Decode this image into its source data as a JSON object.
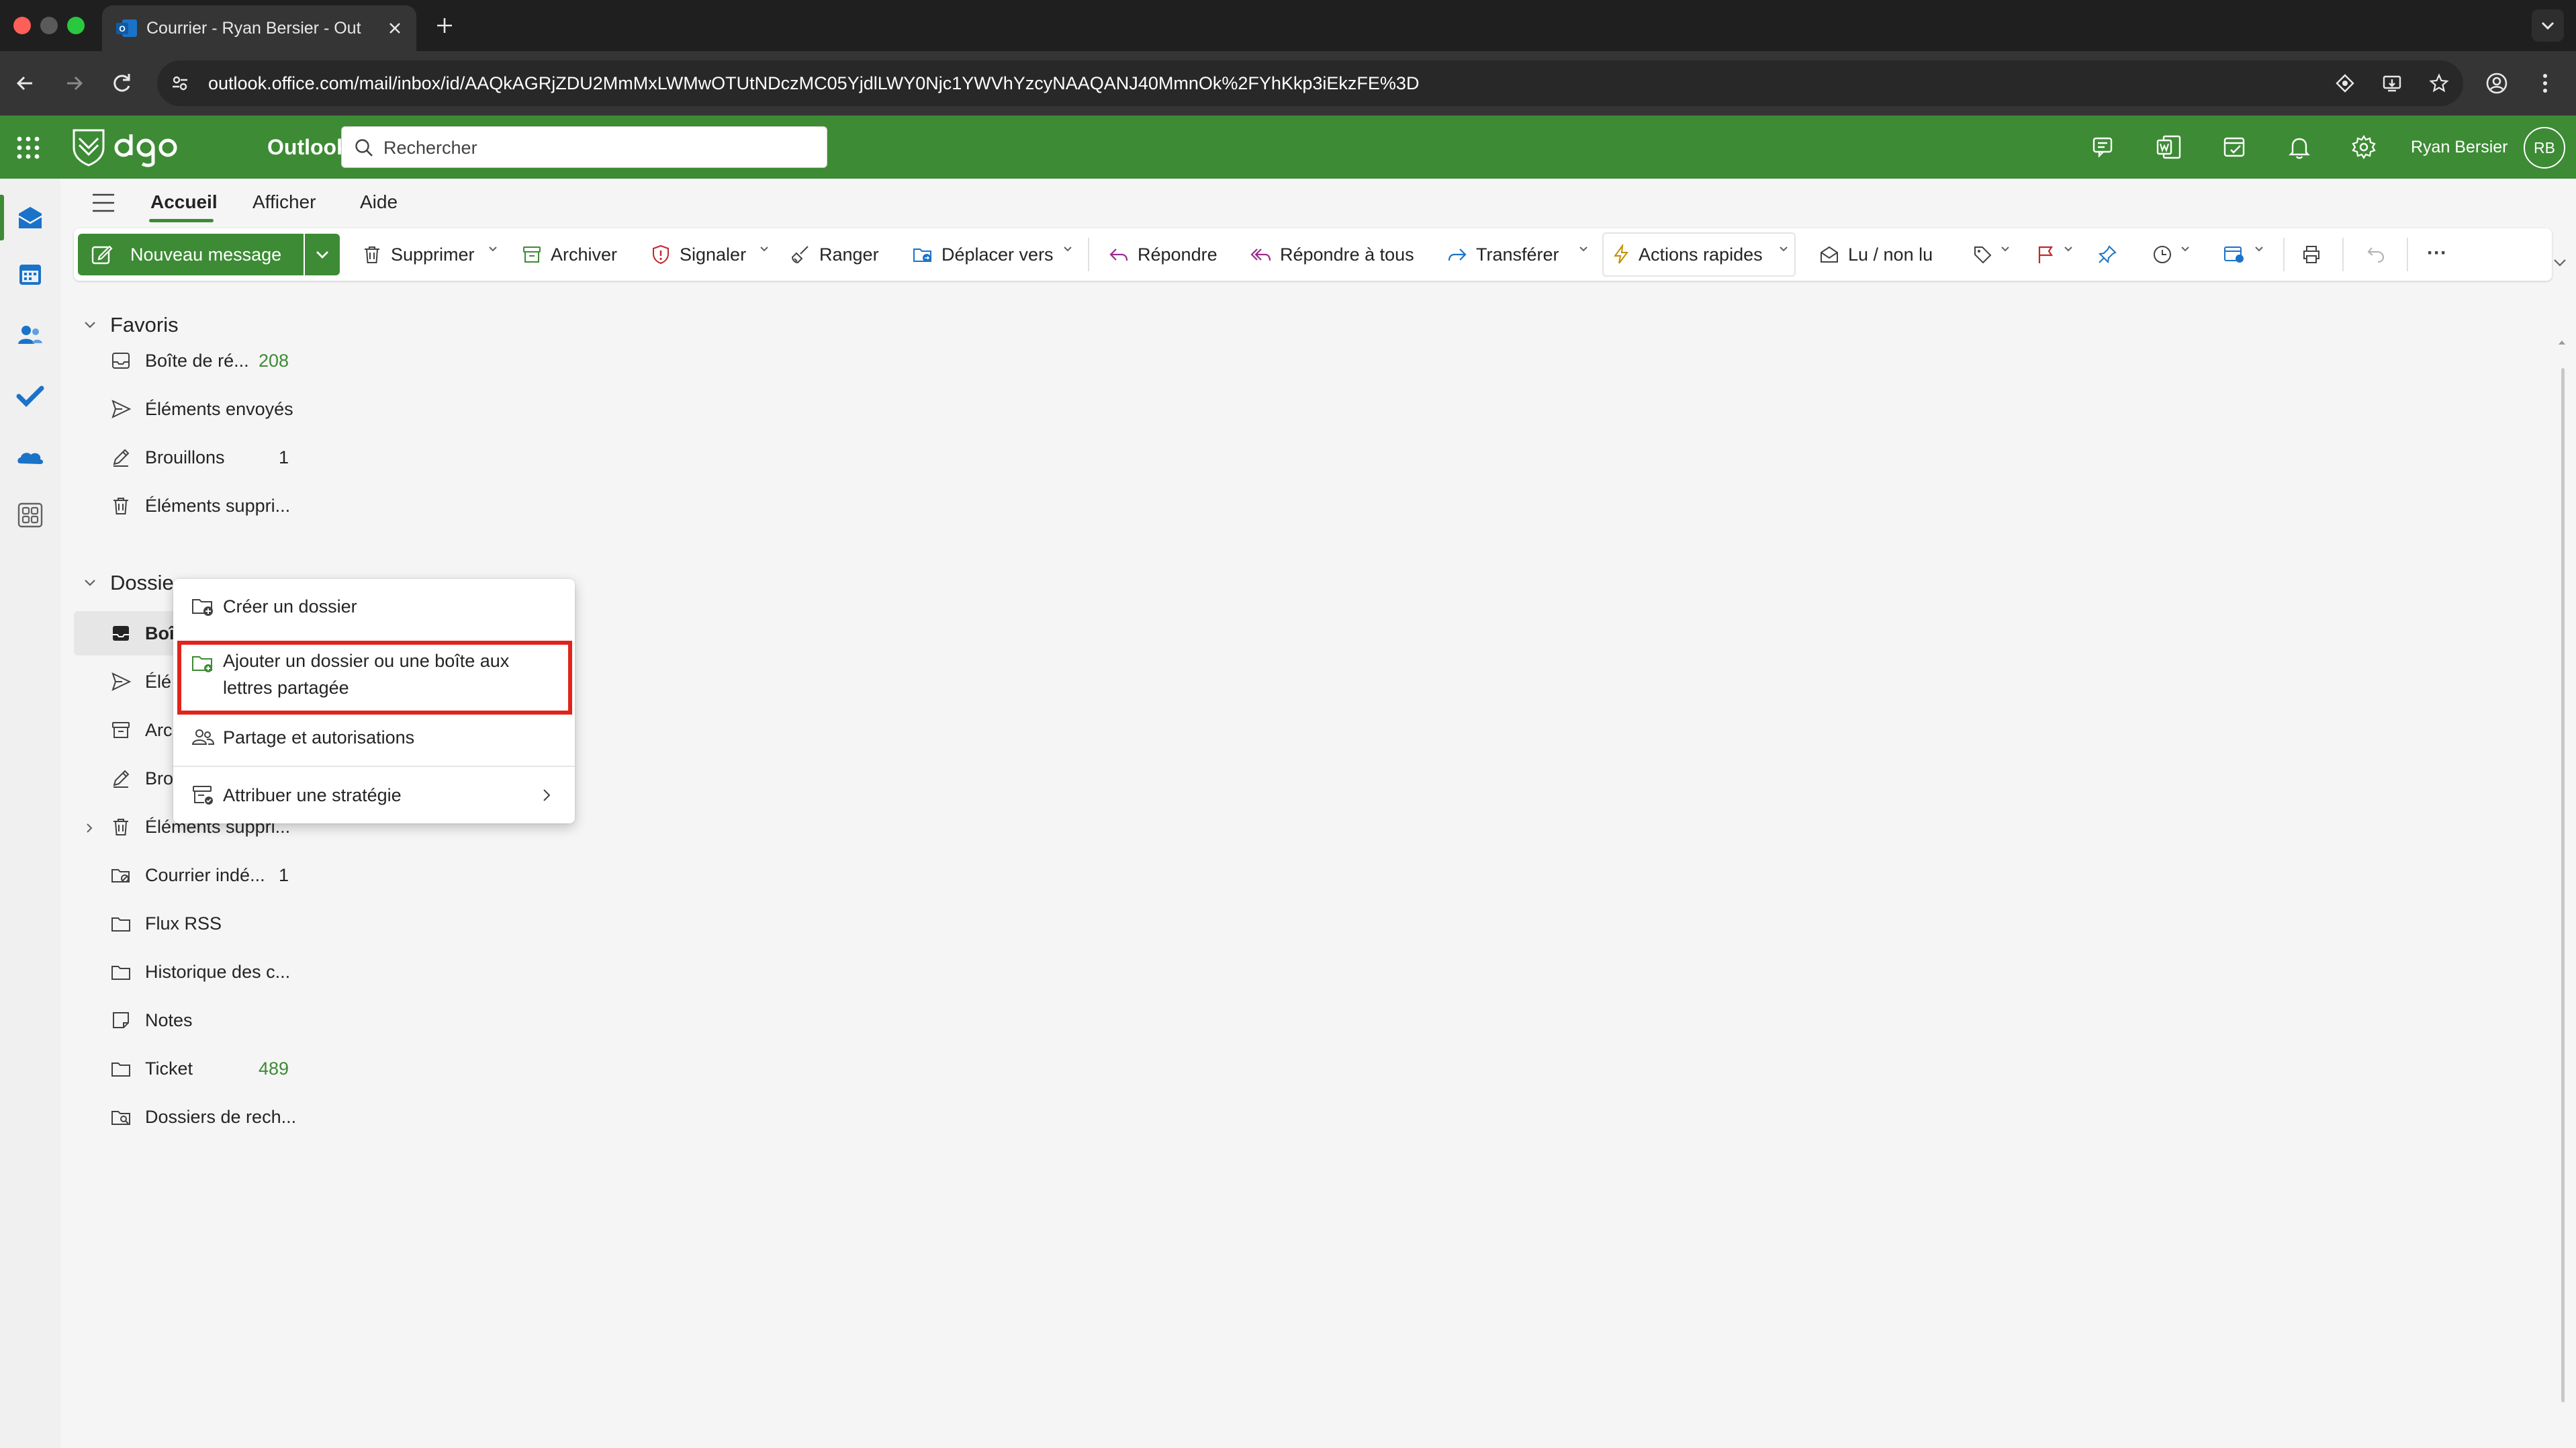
{
  "browser": {
    "tab_title": "Courrier - Ryan Bersier - Outl",
    "url": "outlook.office.com/mail/inbox/id/AAQkAGRjZDU2MmMxLWMwOTUtNDczMC05YjdlLWY0Njc1YWVhYzcyNAAQANJ40MmnOk%2FYhKkp3iEkzFE%3D"
  },
  "header": {
    "app_name": "Outlook",
    "search_placeholder": "Rechercher",
    "user_name": "Ryan Bersier",
    "user_initials": "RB"
  },
  "ribbon": {
    "tabs": [
      {
        "label": "Accueil",
        "active": true
      },
      {
        "label": "Afficher",
        "active": false
      },
      {
        "label": "Aide",
        "active": false
      }
    ],
    "new_message": "Nouveau message",
    "delete": "Supprimer",
    "archive": "Archiver",
    "report": "Signaler",
    "sweep": "Ranger",
    "move_to": "Déplacer vers",
    "reply": "Répondre",
    "reply_all": "Répondre à tous",
    "forward": "Transférer",
    "quick_actions": "Actions rapides",
    "read_unread": "Lu / non lu",
    "more": "···"
  },
  "folders": {
    "favorites_label": "Favoris",
    "favorites": [
      {
        "label": "Boîte de ré...",
        "count": "208",
        "icon": "inbox-icon",
        "unread": true
      },
      {
        "label": "Éléments envoyés",
        "count": "",
        "icon": "send-icon",
        "unread": false
      },
      {
        "label": "Brouillons",
        "count": "1",
        "icon": "draft-icon",
        "unread": false
      },
      {
        "label": "Éléments suppri...",
        "count": "",
        "icon": "trash-icon",
        "unread": false
      }
    ],
    "folders_label": "Dossie",
    "folder_items": [
      {
        "label": "Boî",
        "count": "",
        "icon": "inbox-icon"
      },
      {
        "label": "Élé",
        "count": "",
        "icon": "send-icon"
      },
      {
        "label": "Arc",
        "count": "",
        "icon": "archive-icon"
      },
      {
        "label": "Bro",
        "count": "",
        "icon": "draft-icon"
      },
      {
        "label": "Éléments suppri...",
        "count": "",
        "icon": "trash-icon"
      },
      {
        "label": "Courrier indé...",
        "count": "1",
        "icon": "junk-icon"
      },
      {
        "label": "Flux RSS",
        "count": "",
        "icon": "folder-icon"
      },
      {
        "label": "Historique des c...",
        "count": "",
        "icon": "folder-icon"
      },
      {
        "label": "Notes",
        "count": "",
        "icon": "notes-icon"
      },
      {
        "label": "Ticket",
        "count": "489",
        "icon": "folder-icon"
      },
      {
        "label": "Dossiers de rech...",
        "count": "",
        "icon": "search-folder-icon"
      }
    ]
  },
  "context_menu": {
    "items": [
      {
        "label": "Créer un dossier",
        "icon": "new-folder-icon"
      },
      {
        "label_line1": "Ajouter un dossier ou une boîte aux",
        "label_line2": "lettres partagée",
        "icon": "add-shared-folder-icon",
        "highlighted": true
      },
      {
        "label": "Partage et autorisations",
        "icon": "people-icon"
      },
      {
        "label": "Attribuer une stratégie",
        "icon": "policy-icon",
        "has_submenu": true
      }
    ]
  },
  "colors": {
    "brand_green": "#3d8b35",
    "highlight_red": "#e0241b",
    "unread_count": "#3d8b35"
  }
}
